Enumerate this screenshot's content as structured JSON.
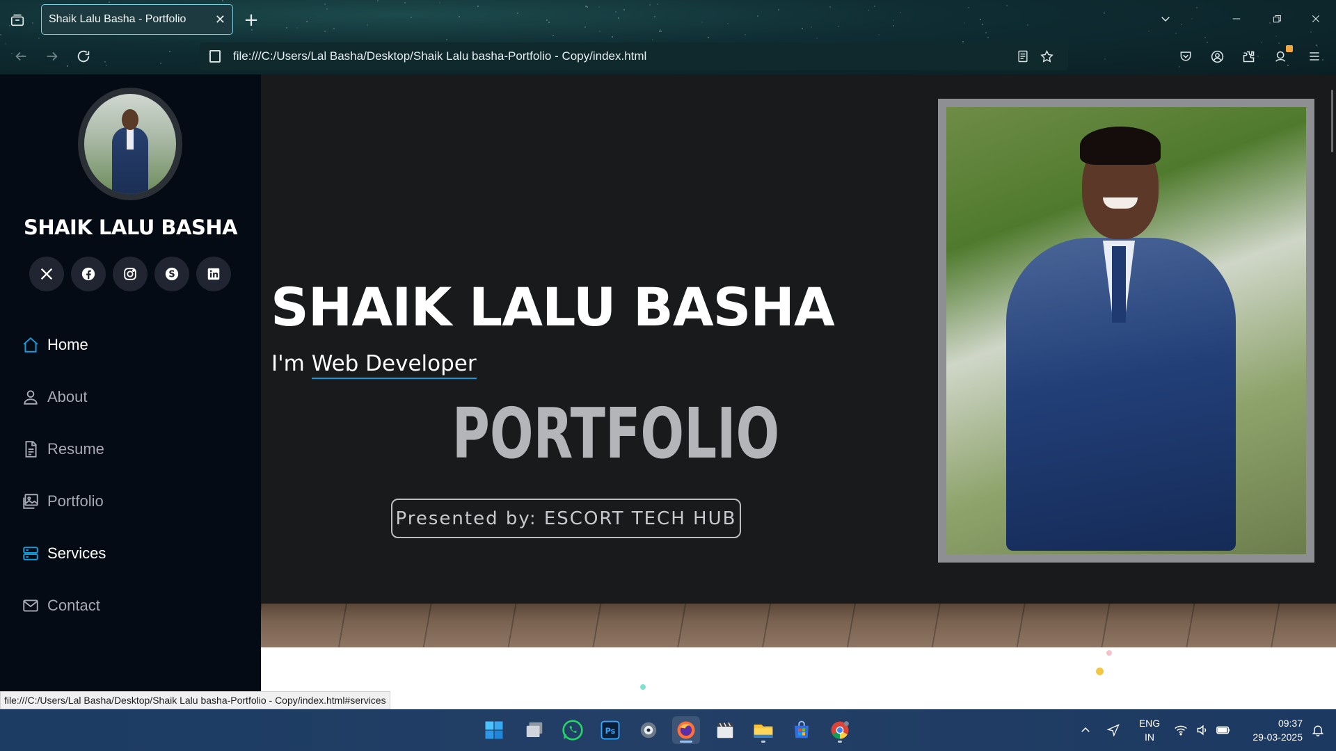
{
  "browser": {
    "tab_title": "Shaik Lalu Basha - Portfolio",
    "url": "file:///C:/Users/Lal Basha/Desktop/Shaik Lalu basha-Portfolio - Copy/index.html",
    "status_url": "file:///C:/Users/Lal Basha/Desktop/Shaik Lalu basha-Portfolio - Copy/index.html#services"
  },
  "sidebar": {
    "name": "SHAIK LALU BASHA",
    "socials": [
      "x-icon",
      "facebook-icon",
      "instagram-icon",
      "skype-icon",
      "linkedin-icon"
    ],
    "menu": [
      {
        "label": "Home",
        "icon": "house-icon",
        "active": true
      },
      {
        "label": "About",
        "icon": "person-icon",
        "active": false
      },
      {
        "label": "Resume",
        "icon": "document-icon",
        "active": false
      },
      {
        "label": "Portfolio",
        "icon": "images-icon",
        "active": false
      },
      {
        "label": "Services",
        "icon": "server-icon",
        "active": true
      },
      {
        "label": "Contact",
        "icon": "envelope-icon",
        "active": false
      }
    ],
    "accent_color": "#149ddd"
  },
  "hero": {
    "title": "SHAIK LALU BASHA",
    "subtitle_prefix": "I'm",
    "subtitle_typed": "Web Developer",
    "big_word": "PORTFOLIO",
    "presented_by": "Presented by: ESCORT TECH HUB"
  },
  "taskbar": {
    "apps": [
      "windows-start-icon",
      "task-view-icon",
      "whatsapp-icon",
      "photoshop-icon",
      "media-app-icon",
      "firefox-icon",
      "clapper-icon",
      "file-explorer-icon",
      "store-icon",
      "chrome-icon"
    ],
    "lang_line1": "ENG",
    "lang_line2": "IN",
    "time": "09:37",
    "date": "29-03-2025"
  }
}
